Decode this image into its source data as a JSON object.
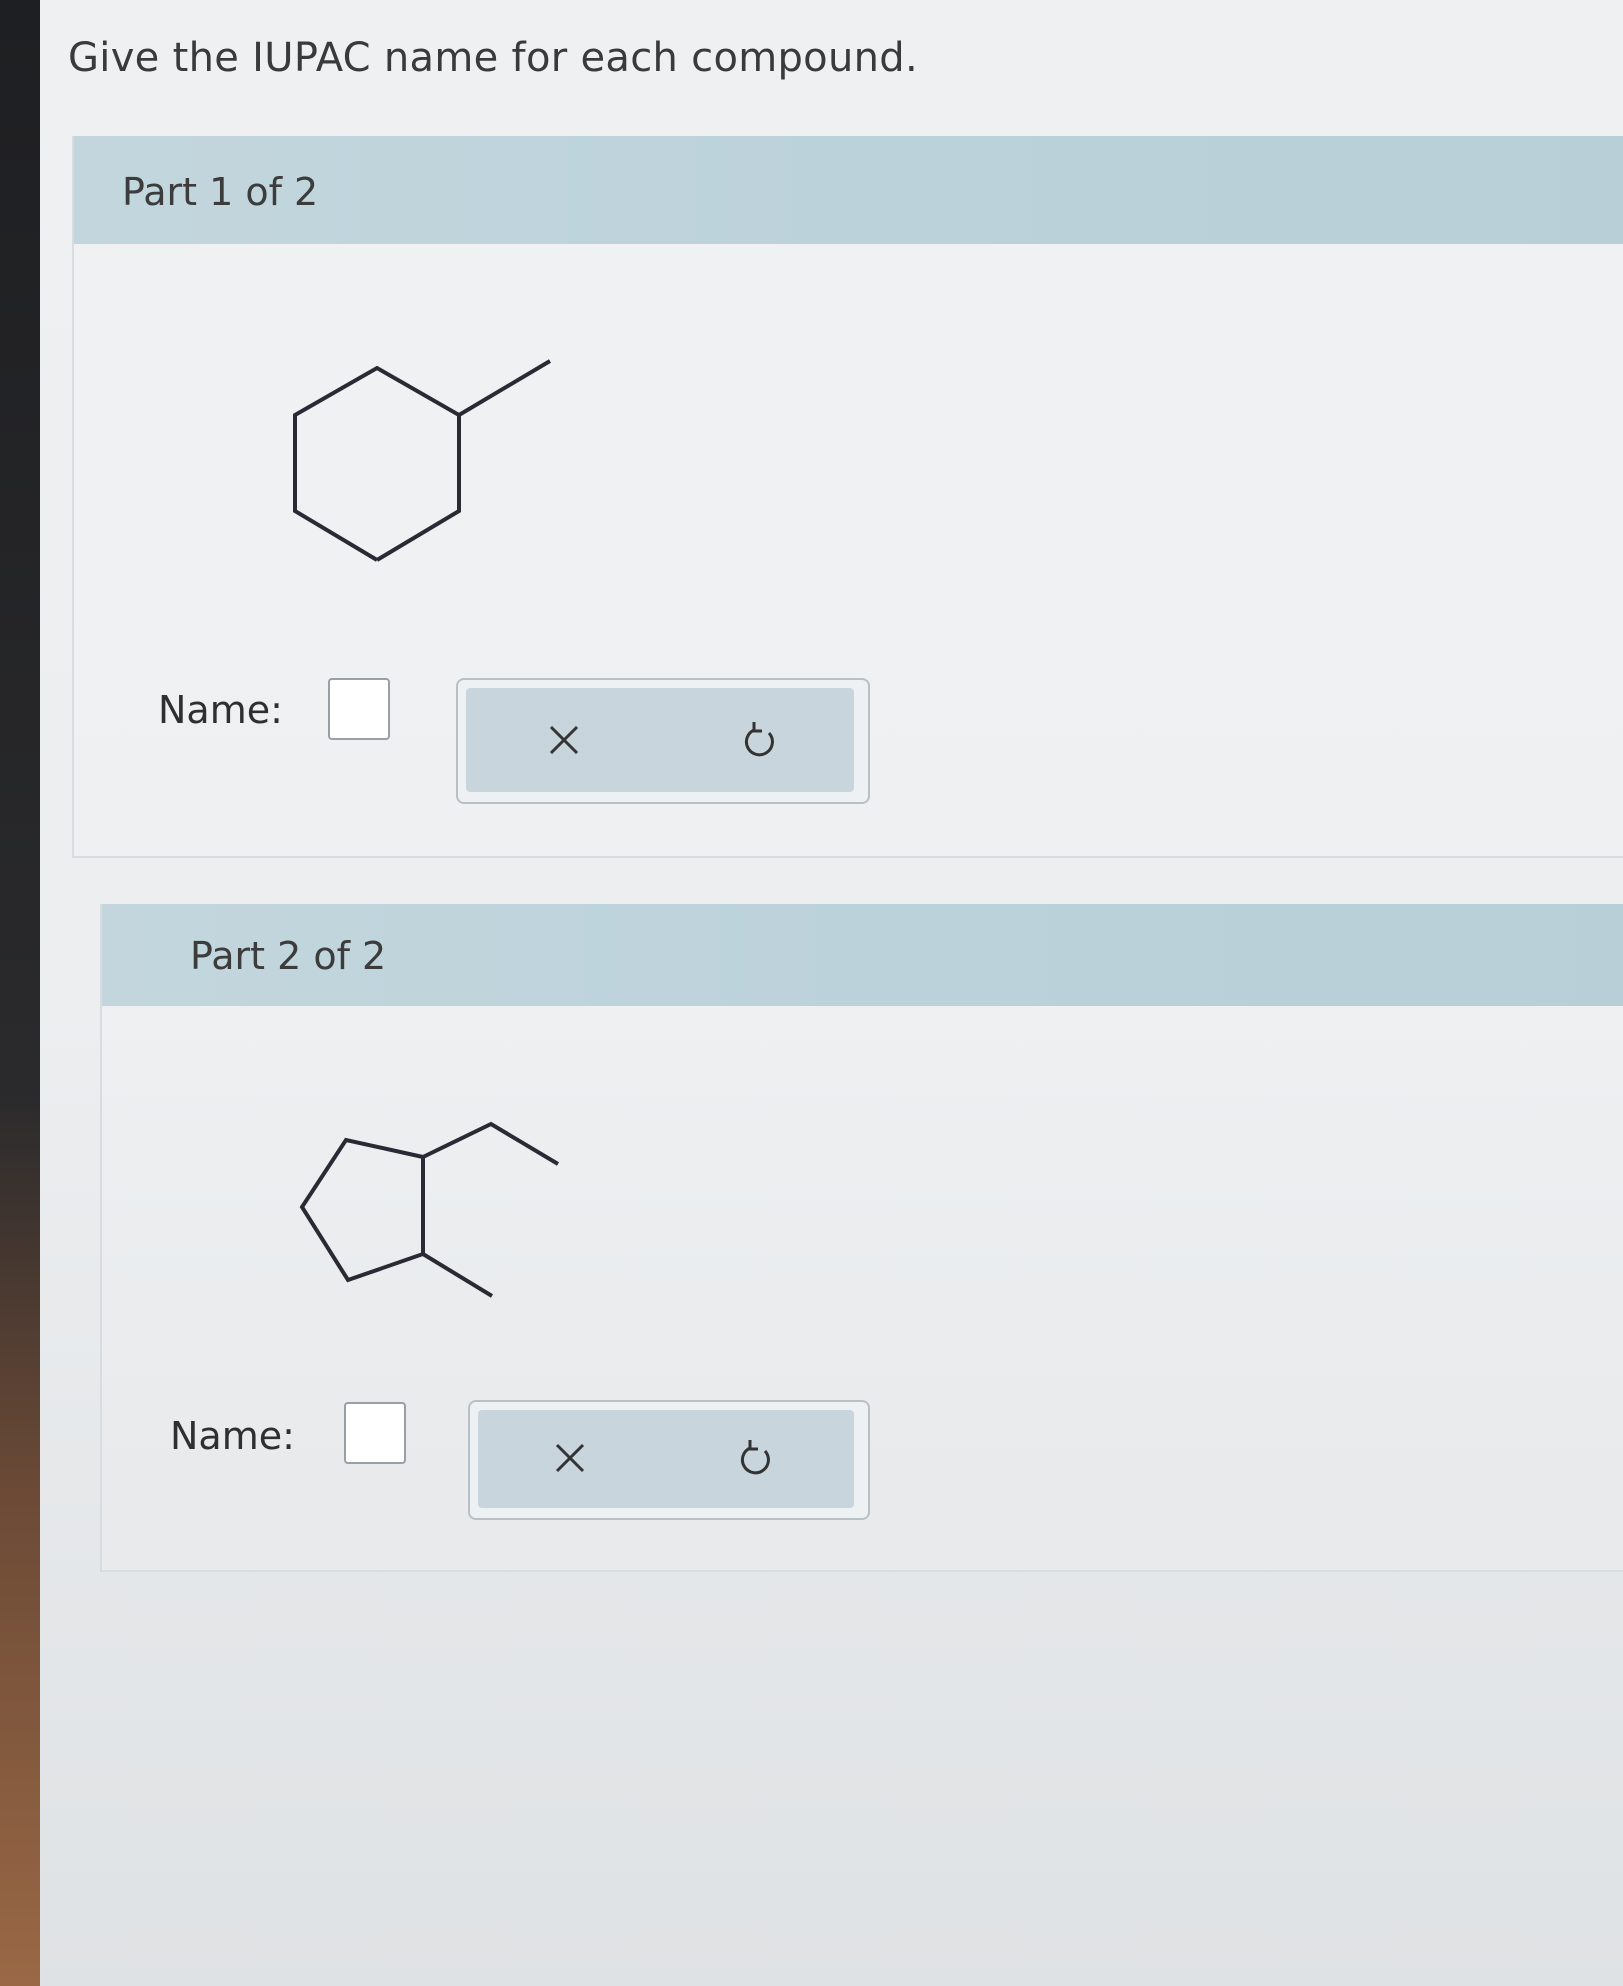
{
  "question": "Give the IUPAC name for each compound.",
  "parts": [
    {
      "title": "Part 1 of 2",
      "name_label": "Name:",
      "answer_value": "",
      "molecule_icon": "methylcyclohexane-structure",
      "tools": {
        "clear_icon": "x-icon",
        "undo_icon": "undo-icon"
      }
    },
    {
      "title": "Part 2 of 2",
      "name_label": "Name:",
      "answer_value": "",
      "molecule_icon": "ethyl-methyl-cyclopentane-structure",
      "tools": {
        "clear_icon": "x-icon",
        "undo_icon": "undo-icon"
      }
    }
  ],
  "colors": {
    "header": "#bcd2da",
    "tool_panel": "#c9d5dc",
    "bond_line": "#2a2a35"
  }
}
